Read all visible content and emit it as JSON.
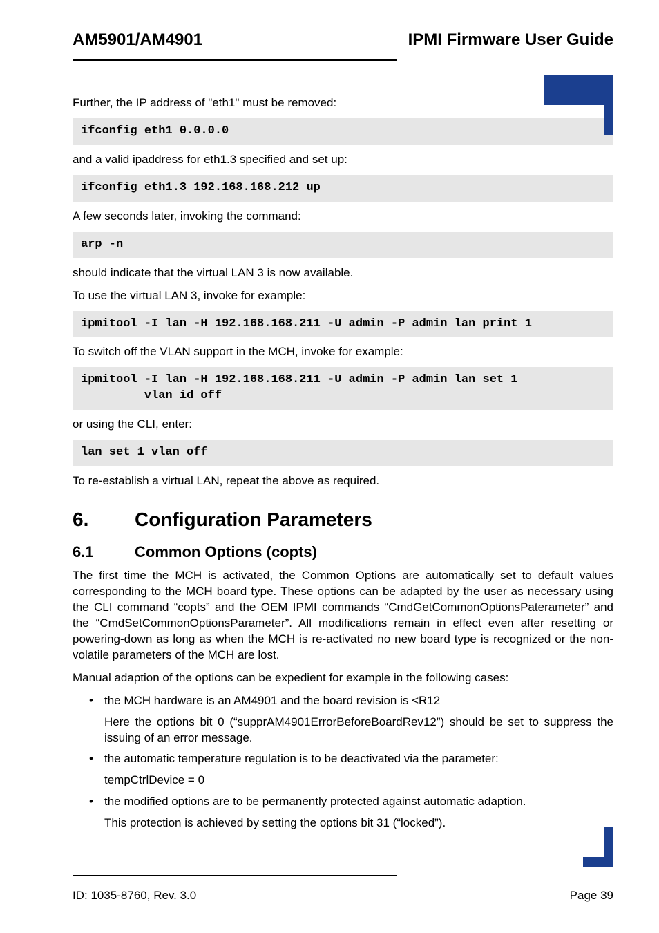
{
  "header": {
    "left": "AM5901/AM4901",
    "right": "IPMI Firmware User Guide"
  },
  "body": {
    "p1": "Further, the IP address of \"eth1\" must be removed:",
    "code1": "ifconfig eth1 0.0.0.0",
    "p2": "and a valid ipaddress for eth1.3 specified and set up:",
    "code2": "ifconfig eth1.3 192.168.168.212 up",
    "p3": "A few seconds later, invoking the command:",
    "code3": "arp -n",
    "p4": "should indicate that the virtual LAN 3 is now available.",
    "p5": "To use the virtual LAN 3, invoke for example:",
    "code4": "ipmitool -I lan -H 192.168.168.211 -U admin -P admin lan print 1",
    "p6": "To switch off the VLAN support in the MCH, invoke for example:",
    "code5": "ipmitool -I lan -H 192.168.168.211 -U admin -P admin lan set 1\n         vlan id off",
    "p7": "or using the CLI, enter:",
    "code6": "lan set 1 vlan off",
    "p8": "To re-establish a virtual LAN, repeat the above as required."
  },
  "sec6": {
    "num": "6.",
    "title": "Configuration Parameters"
  },
  "sec61": {
    "num": "6.1",
    "title": "Common Options (copts)",
    "p1": "The first time the MCH is activated, the Common Options are automatically set to default values corresponding to the MCH board type. These options can be adapted by the user as necessary using the CLI command “copts” and the OEM IPMI commands “CmdGetCommonOptionsPaterameter” and the “CmdSetCommonOptionsParameter”. All modifications remain in effect even after resetting or powering-down as long as when the MCH is re-activated no new board type is recognized or the non-volatile parameters of the MCH are lost.",
    "p2": "Manual adaption of the options can be expedient for example in the following cases:",
    "b1": "the MCH hardware is an AM4901 and the board revision is <R12",
    "b1p": "Here the options bit 0 (“supprAM4901ErrorBeforeBoardRev12”) should be set to suppress the issuing of an error message.",
    "b2": "the automatic temperature regulation is to be deactivated via the parameter:",
    "b2p": "tempCtrlDevice = 0",
    "b3": "the modified options are to be permanently protected against automatic adaption.",
    "b3p": "This protection is achieved by setting the options bit 31 (“locked”)."
  },
  "footer": {
    "left": "ID: 1035-8760, Rev. 3.0",
    "right": "Page 39"
  }
}
